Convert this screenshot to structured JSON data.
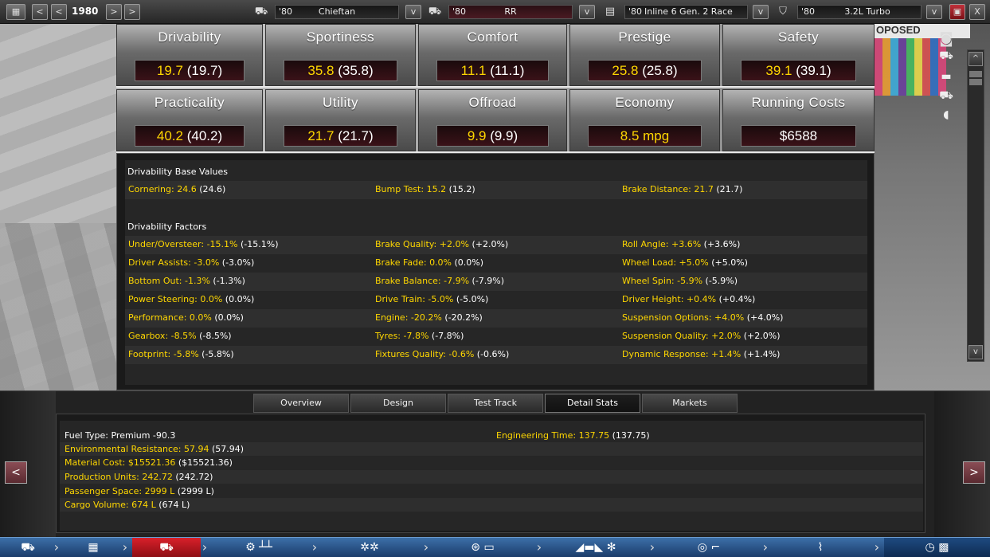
{
  "topbar": {
    "year": "1980",
    "prev_label": "<",
    "next_label": ">",
    "dropdown_label": "v",
    "model": {
      "year": "'80",
      "name": "Chieftan"
    },
    "trim": {
      "year": "'80",
      "name": "RR"
    },
    "engine": {
      "year": "'80",
      "name": "Inline 6 Gen. 2 Race"
    },
    "variant": {
      "year": "'80",
      "name": "3.2L Turbo"
    },
    "close_label": "X",
    "save_icon": "save-icon"
  },
  "stats": [
    {
      "title": "Drivability",
      "value": "19.7",
      "paren": "(19.7)"
    },
    {
      "title": "Sportiness",
      "value": "35.8",
      "paren": "(35.8)"
    },
    {
      "title": "Comfort",
      "value": "11.1",
      "paren": "(11.1)"
    },
    {
      "title": "Prestige",
      "value": "25.8",
      "paren": "(25.8)"
    },
    {
      "title": "Safety",
      "value": "39.1",
      "paren": "(39.1)"
    },
    {
      "title": "Practicality",
      "value": "40.2",
      "paren": "(40.2)"
    },
    {
      "title": "Utility",
      "value": "21.7",
      "paren": "(21.7)"
    },
    {
      "title": "Offroad",
      "value": "9.9",
      "paren": "(9.9)"
    },
    {
      "title": "Economy",
      "value": "8.5 mpg",
      "paren": ""
    },
    {
      "title": "Running Costs",
      "value": "$6588",
      "paren": ""
    }
  ],
  "drivability": {
    "base_header": "Drivability Base Values",
    "base": [
      {
        "k": "Cornering: 24.6",
        "p": "(24.6)"
      },
      {
        "k": "Bump Test: 15.2",
        "p": "(15.2)"
      },
      {
        "k": "Brake Distance: 21.7",
        "p": "(21.7)"
      }
    ],
    "factors_header": "Drivability Factors",
    "factors": [
      [
        {
          "k": "Under/Oversteer: -15.1%",
          "p": "(-15.1%)"
        },
        {
          "k": "Brake Quality: +2.0%",
          "p": "(+2.0%)"
        },
        {
          "k": "Roll Angle: +3.6%",
          "p": "(+3.6%)"
        }
      ],
      [
        {
          "k": "Driver Assists: -3.0%",
          "p": "(-3.0%)"
        },
        {
          "k": "Brake Fade: 0.0%",
          "p": "(0.0%)"
        },
        {
          "k": "Wheel Load: +5.0%",
          "p": "(+5.0%)"
        }
      ],
      [
        {
          "k": "Bottom Out: -1.3%",
          "p": "(-1.3%)"
        },
        {
          "k": "Brake Balance: -7.9%",
          "p": "(-7.9%)"
        },
        {
          "k": "Wheel Spin: -5.9%",
          "p": "(-5.9%)"
        }
      ],
      [
        {
          "k": "Power Steering: 0.0%",
          "p": "(0.0%)"
        },
        {
          "k": "Drive Train: -5.0%",
          "p": "(-5.0%)"
        },
        {
          "k": "Driver Height: +0.4%",
          "p": "(+0.4%)"
        }
      ],
      [
        {
          "k": "Performance: 0.0%",
          "p": "(0.0%)"
        },
        {
          "k": "Engine: -20.2%",
          "p": "(-20.2%)"
        },
        {
          "k": "Suspension Options: +4.0%",
          "p": "(+4.0%)"
        }
      ],
      [
        {
          "k": "Gearbox: -8.5%",
          "p": "(-8.5%)"
        },
        {
          "k": "Tyres: -7.8%",
          "p": "(-7.8%)"
        },
        {
          "k": "Suspension Quality: +2.0%",
          "p": "(+2.0%)"
        }
      ],
      [
        {
          "k": "Footprint: -5.8%",
          "p": "(-5.8%)"
        },
        {
          "k": "Fixtures Quality: -0.6%",
          "p": "(-0.6%)"
        },
        {
          "k": "Dynamic Response: +1.4%",
          "p": "(+1.4%)"
        }
      ]
    ]
  },
  "side_icons": [
    "camera-icon",
    "car-front-icon",
    "car-side-icon",
    "car-rear-icon",
    "car-top-icon"
  ],
  "scroll": {
    "up": "^",
    "down": "v"
  },
  "tabs": [
    "Overview",
    "Design",
    "Test Track",
    "Detail Stats",
    "Markets"
  ],
  "active_tab": "Detail Stats",
  "detail": {
    "fuel_type": "Fuel Type: Premium -90.3",
    "engineering_time": {
      "k": "Engineering Time: 137.75",
      "p": "(137.75)"
    },
    "rows": [
      {
        "k": "Environmental Resistance: 57.94",
        "p": "(57.94)"
      },
      {
        "k": "Material Cost: $15521.36",
        "p": "($15521.36)"
      },
      {
        "k": "Production Units: 242.72",
        "p": "(242.72)"
      },
      {
        "k": "Passenger Space: 2999 L",
        "p": "(2999 L)"
      },
      {
        "k": "Cargo Volume: 674 L",
        "p": "(674 L)"
      }
    ]
  },
  "nav": {
    "prev": "<",
    "next": ">"
  },
  "taskbar": [
    "car-body-icon",
    "engine-icon",
    "car-model-icon",
    "drivetrain-icon",
    "wheels-icon",
    "brakes-icon",
    "aero-icon",
    "interior-icon",
    "suspension-icon",
    "test-track-icon"
  ],
  "colors": {
    "value_yellow": "#ffd700",
    "active_tab": "#111111",
    "taskbar_active": "#d8202a",
    "taskbar": "#2a5a90"
  }
}
